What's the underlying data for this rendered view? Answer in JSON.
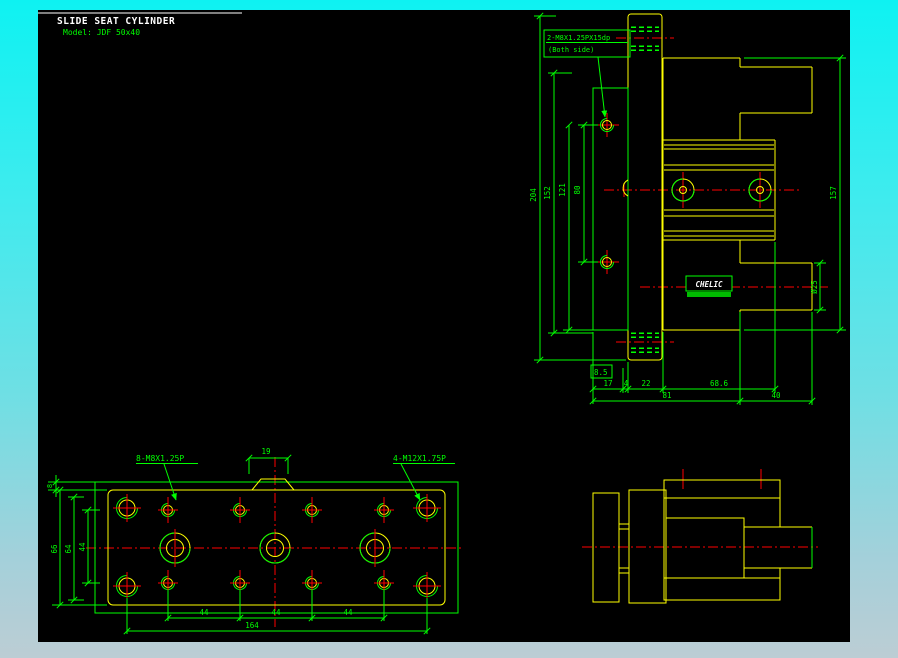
{
  "title": {
    "line1": "SLIDE SEAT CYLINDER",
    "line2": "Model: JDF 50x40"
  },
  "logo": "CHELIC",
  "notes": {
    "flange1": "2-M8X1.25PX15dp",
    "flange2": "(Both side)",
    "m8": "8-M8X1.25P",
    "m12": "4-M12X1.75P"
  },
  "dims": {
    "d204": "204",
    "d152": "152",
    "d121": "121",
    "d80": "80",
    "d157": "157",
    "dia25": "Ø25",
    "d8_5": "8.5",
    "d17": "17",
    "d4": "4",
    "d22": "22",
    "d68_6": "68.6",
    "d81": "81",
    "d40": "40",
    "d19": "19",
    "d8": "8",
    "d66": "66",
    "d64": "64",
    "d44L": "44",
    "d44a": "44",
    "d44b": "44",
    "d44c": "44",
    "d164": "164"
  },
  "colors": {
    "canvas": "#000000",
    "geometry": "#ffff00",
    "dimension": "#00ff00",
    "centerline": "#ff0000",
    "text": "#ffffff",
    "border_top": "#0ef2f2",
    "border_bottom": "#bccdd4"
  }
}
